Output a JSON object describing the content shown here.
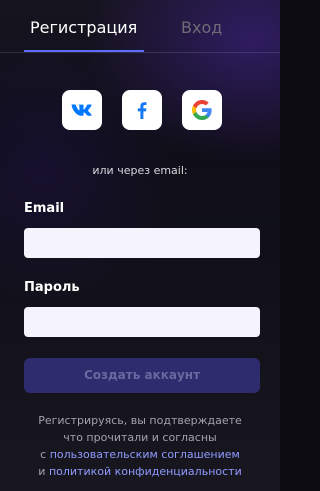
{
  "tabs": {
    "register": "Регистрация",
    "login": "Вход"
  },
  "social": {
    "vk_label": "VK",
    "facebook_label": "f",
    "google_label": "G",
    "icons": [
      "vk-icon",
      "facebook-icon",
      "google-icon"
    ]
  },
  "divider_text": "или через email:",
  "form": {
    "email_label": "Email",
    "email_value": "",
    "password_label": "Пароль",
    "password_value": "",
    "submit_label": "Создать аккаунт"
  },
  "legal": {
    "line1": "Регистрируясь, вы подтверждаете",
    "line2": "что прочитали и согласны",
    "prefix": "с ",
    "agreement_link": "пользовательским соглашением",
    "conjunction": "и ",
    "privacy_link": "политикой конфиденциальности"
  },
  "colors": {
    "accent": "#5b6cff",
    "button_bg": "#2e2b6e",
    "button_text": "#6a68a0",
    "link": "#8f9bff",
    "vk": "#0077ff",
    "facebook": "#1877f2"
  }
}
